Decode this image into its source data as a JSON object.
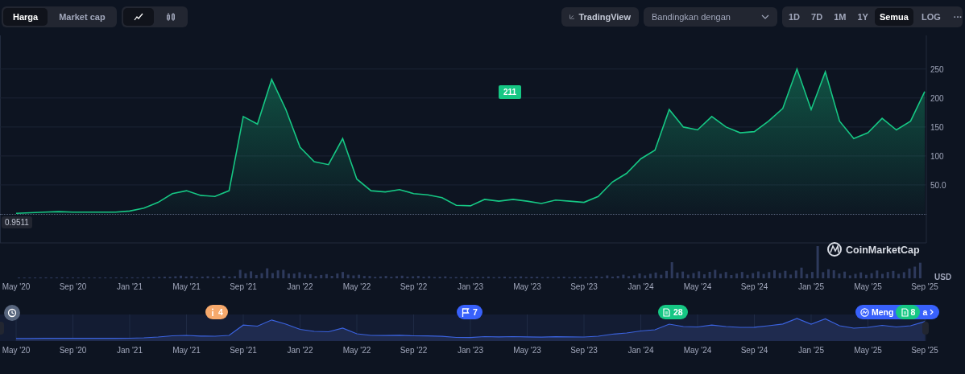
{
  "toolbar": {
    "metric_tabs": [
      {
        "label": "Harga",
        "selected": true
      },
      {
        "label": "Market cap",
        "selected": false
      }
    ],
    "chart_type_tabs": [
      {
        "kind": "line",
        "selected": true
      },
      {
        "kind": "candle",
        "selected": false
      }
    ],
    "tradingview_button": "TradingView",
    "compare_dropdown": {
      "placeholder": "Bandingkan dengan"
    },
    "range_tabs": [
      {
        "label": "1D",
        "selected": false
      },
      {
        "label": "7D",
        "selected": false
      },
      {
        "label": "1M",
        "selected": false
      },
      {
        "label": "1Y",
        "selected": false
      },
      {
        "label": "Semua",
        "selected": true
      }
    ],
    "log_button": "LOG",
    "more_button": "···"
  },
  "chart": {
    "current_price": "211",
    "start_price": "0.9511",
    "currency": "USD",
    "watermark": "CoinMarketCap",
    "chart_data": {
      "type": "area",
      "categories": [
        "May '20",
        null,
        null,
        null,
        "Sep '20",
        null,
        null,
        null,
        "Jan '21",
        null,
        null,
        null,
        "May '21",
        null,
        null,
        null,
        "Sep '21",
        null,
        null,
        null,
        "Jan '22",
        null,
        null,
        null,
        "May '22",
        null,
        null,
        null,
        "Sep '22",
        null,
        null,
        null,
        "Jan '23",
        null,
        null,
        null,
        "May '23",
        null,
        null,
        null,
        "Sep '23",
        null,
        null,
        null,
        "Jan '24",
        null,
        null,
        null,
        "May '24",
        null,
        null,
        null,
        "Sep '24",
        null,
        null,
        null,
        "Jan '25",
        null,
        null,
        null,
        "May '25",
        null,
        null,
        null,
        "Sep '25"
      ],
      "series": [
        {
          "color": "#16c784",
          "values": [
            1,
            2,
            3,
            4,
            3,
            3,
            3,
            3,
            5,
            10,
            20,
            35,
            40,
            32,
            30,
            40,
            168,
            155,
            232,
            180,
            115,
            90,
            85,
            130,
            60,
            40,
            38,
            42,
            35,
            33,
            28,
            15,
            14,
            25,
            22,
            25,
            22,
            18,
            24,
            22,
            20,
            30,
            55,
            70,
            95,
            110,
            180,
            150,
            145,
            168,
            150,
            140,
            142,
            160,
            182,
            250,
            180,
            245,
            160,
            130,
            140,
            165,
            145,
            160,
            211
          ]
        }
      ],
      "grid": true,
      "ylim": [
        -50,
        308
      ],
      "yticks": [
        {
          "value": 50,
          "label": "50.0"
        },
        {
          "value": 100,
          "label": "100"
        },
        {
          "value": 150,
          "label": "150"
        },
        {
          "value": 200,
          "label": "200"
        },
        {
          "value": 250,
          "label": "250"
        }
      ]
    }
  },
  "navigator": {
    "events": [
      {
        "kind": "history",
        "color": "#58667e"
      },
      {
        "kind": "info",
        "count": "4",
        "color": "#f6a96c"
      },
      {
        "kind": "flag",
        "count": "7",
        "color": "#3861fb"
      },
      {
        "kind": "doc",
        "count": "28",
        "color": "#16c784"
      },
      {
        "kind": "learn",
        "parts": [
          "Meng",
          "a"
        ],
        "color": "#3861fb"
      },
      {
        "kind": "doc",
        "count": "8",
        "color": "#16c784"
      }
    ],
    "axis_labels": [
      "May '20",
      "Sep '20",
      "Jan '21",
      "May '21",
      "Sep '21",
      "Jan '22",
      "May '22",
      "Sep '22",
      "Jan '23",
      "May '23",
      "Sep '23",
      "Jan '24",
      "May '24",
      "Sep '24",
      "Jan '25",
      "May '25",
      "Sep '25"
    ]
  }
}
